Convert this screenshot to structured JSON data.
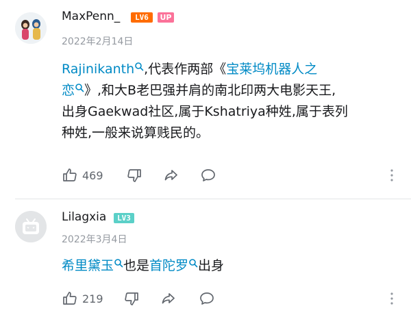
{
  "comments": [
    {
      "username": "MaxPenn_",
      "level_badge": "LV6",
      "up_badge": "UP",
      "date": "2022年2月14日",
      "text": {
        "l1_link": "Rajinikanth",
        "l1_rest": ",代表作两部《",
        "l1_link2": "宝莱坞机器人之",
        "l2_link": "恋",
        "l2_rest": "》,和大B老巴强并肩的南北印两大电影天王,",
        "l3": "出身Gaekwad社区,属于Kshatriya种姓,属于表列",
        "l4": "种姓,一般来说算贱民的。"
      },
      "like_count": "469"
    },
    {
      "username": "Lilagxia",
      "level_badge": "LV3",
      "date": "2022年3月4日",
      "text": {
        "link1": "希里黛玉",
        "mid": "也是",
        "link2": "首陀罗",
        "end": "出身"
      },
      "like_count": "219"
    }
  ],
  "colors": {
    "link": "#008ac5",
    "lv6": "#ff6c00",
    "lv3": "#5bd0c8",
    "up": "#fb7299",
    "meta": "#9499a0"
  },
  "icons": [
    "thumbs-up-icon",
    "thumbs-down-icon",
    "share-icon",
    "reply-icon",
    "more-icon",
    "search-icon"
  ]
}
